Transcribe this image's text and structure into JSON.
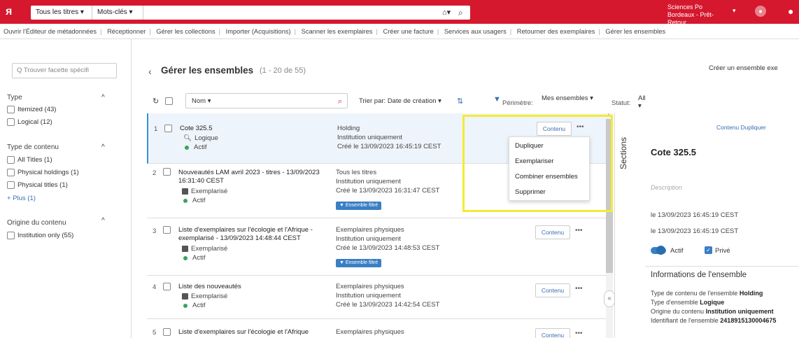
{
  "topbar": {
    "logo": "ᴙ",
    "search_scope": "Tous les titres ▾",
    "search_field": "Mots-clés ▾",
    "home_icon": "home-icon",
    "search_icon": "search-icon",
    "institution": "Sciences Po Bordeaux - Prêt-Retour",
    "institution_caret": "▾"
  },
  "links": [
    "Ouvrir l'Éditeur de métadonnées",
    "Réceptionner",
    "Gérer les collections",
    "Importer (Acquisitions)",
    "Scanner les exemplaires",
    "Créer une facture",
    "Services aux usagers",
    "Retourner des exemplaires",
    "Gérer les ensembles"
  ],
  "facets": {
    "search_placeholder": "Q  Trouver facette spécifi",
    "type_title": "Type",
    "type_items": [
      "Itemized (43)",
      "Logical (12)"
    ],
    "content_title": "Type de contenu",
    "content_items": [
      "All Titles (1)",
      "Physical holdings (1)",
      "Physical titles (1)"
    ],
    "plus": "+ Plus (1)",
    "origin_title": "Origine du contenu",
    "origin_items": [
      "Institution only (55)"
    ],
    "caret": "^"
  },
  "main": {
    "back": "‹",
    "title": "Gérer les ensembles",
    "count": "(1 - 20 de 55)",
    "create_button": "Créer un ensemble exe",
    "name_dropdown": "Nom ▾",
    "sort_label": "Trier par:  Date de création ▾",
    "scope_label": "Périmètre:",
    "scope_value": "Mes ensembles ▾",
    "status_label": "Statut:",
    "status_value": "All ▾"
  },
  "rows": [
    {
      "num": "1",
      "title": "Cote 325.5",
      "type": "Logique",
      "state": "Actif",
      "col2_1": "Holding",
      "col2_2": "Institution uniquement",
      "col2_3": "Créé le 13/09/2023 16:45:19 CEST",
      "badge": "",
      "content": "Contenu",
      "more": "•••"
    },
    {
      "num": "2",
      "title": "Nouveautés LAM avril 2023 - titres - 13/09/2023 16:31:40 CEST",
      "type": "Exemplarisé",
      "state": "Actif",
      "col2_1": "Tous les titres",
      "col2_2": "Institution uniquement",
      "col2_3": "Créé le 13/09/2023 16:31:47 CEST",
      "badge": "Ensemble filtré",
      "content": "Contenu",
      "more": "•••"
    },
    {
      "num": "3",
      "title": "Liste d'exemplaires sur l'écologie et l'Afrique - exemplarisé - 13/09/2023 14:48:44 CEST",
      "type": "Exemplarisé",
      "state": "Actif",
      "col2_1": "Exemplaires physiques",
      "col2_2": "Institution uniquement",
      "col2_3": "Créé le 13/09/2023 14:48:53 CEST",
      "badge": "Ensemble filtré",
      "content": "Contenu",
      "more": "•••"
    },
    {
      "num": "4",
      "title": "Liste des nouveautés",
      "type": "Exemplarisé",
      "state": "Actif",
      "col2_1": "Exemplaires physiques",
      "col2_2": "Institution uniquement",
      "col2_3": "Créé le 13/09/2023 14:42:54 CEST",
      "badge": "",
      "content": "Contenu",
      "more": "•••"
    },
    {
      "num": "5",
      "title": "Liste d'exemplaires sur l'écologie et l'Afrique",
      "type": "",
      "state": "",
      "col2_1": "Exemplaires physiques",
      "col2_2": "",
      "col2_3": "",
      "badge": "",
      "content": "Contenu",
      "more": "•••"
    }
  ],
  "menu": [
    "Dupliquer",
    "Exemplariser",
    "Combiner ensembles",
    "Supprimer"
  ],
  "sections_label": "Sections",
  "right_pane": {
    "buttons": "Contenu   Dupliquer",
    "title": "Cote 325.5",
    "description": "Description",
    "date1": "le 13/09/2023 16:45:19 CEST",
    "date2": "le 13/09/2023 16:45:19 CEST",
    "active": "Actif",
    "private": "Privé",
    "info_title": "Informations de l'ensemble",
    "info1_label": "Type de contenu de l'ensemble",
    "info1_value": "Holding",
    "info2_label": "Type d'ensemble",
    "info2_value": "Logique",
    "info3_label": "Origine du contenu",
    "info3_value": "Institution uniquement",
    "info4_label": "Identifiant de l'ensemble",
    "info4_value": "2418915130004675"
  }
}
